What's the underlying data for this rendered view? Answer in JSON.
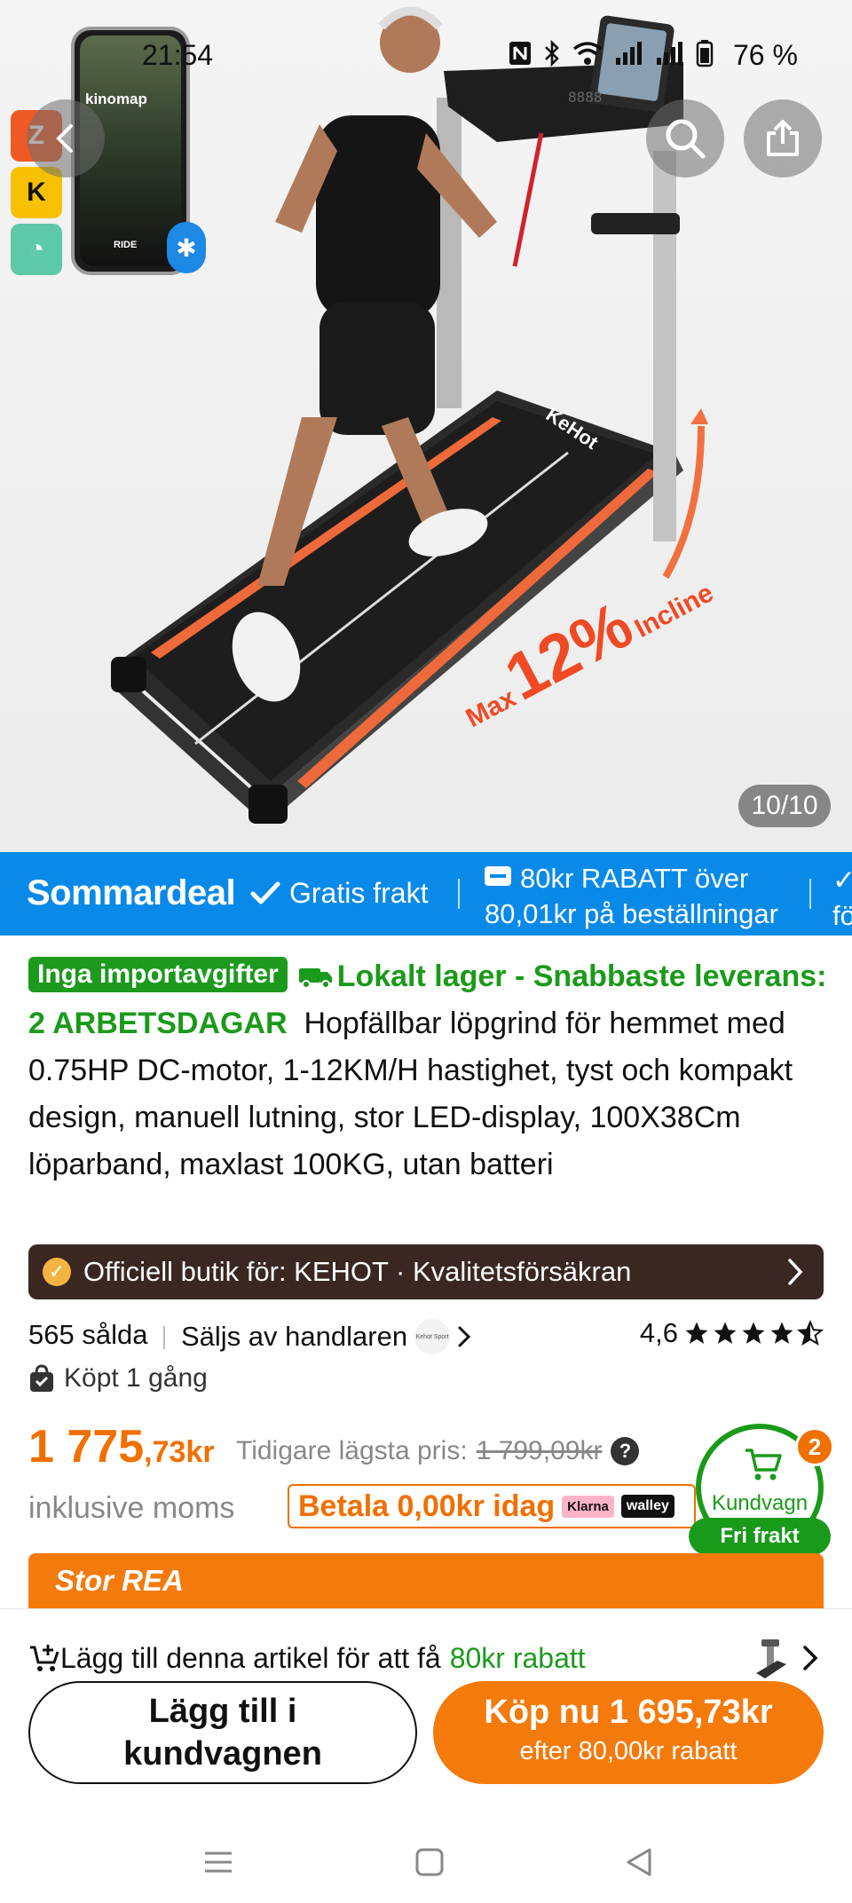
{
  "status_bar": {
    "time": "21:54",
    "battery": "76 %",
    "icons": [
      "nfc-icon",
      "bluetooth-icon",
      "wifi-icon",
      "signal-icon",
      "signal-icon",
      "battery-icon"
    ]
  },
  "hero": {
    "image_counter": "10/10",
    "phone_brand": "kinomap",
    "phone_label": "RIDE",
    "treadmill_brand": "KeHot",
    "incline_text_max": "Max",
    "incline_text_pct": "12%",
    "incline_text_label": "Incline",
    "console_digits": "8888"
  },
  "promo": {
    "title": "Sommardeal",
    "free_shipping": "Gratis frakt",
    "discount_line1": "80kr RABATT över",
    "discount_line2": "80,01kr på beställningar",
    "trailing_line1": "",
    "trailing_line2": "fö"
  },
  "description": {
    "tag": "Inga importavgifter",
    "local_stock": "Lokalt lager - Snabbaste leverans: 2 ARBETSDAGAR",
    "text": "Hopfällbar löpgrind för hemmet med 0.75HP DC-motor, 1-12KM/H hastighet, tyst och kompakt design, manuell lutning, stor LED-display, 100X38Cm löparband, maxlast 100KG, utan batteri"
  },
  "store": {
    "label": "Officiell butik för: KEHOT · Kvalitetsförsäkran"
  },
  "stats": {
    "sold": "565 sålda",
    "seller": "Säljs av handlaren",
    "seller_logo": "Kehot Sport",
    "rating_value": "4,6",
    "rating": 4.6,
    "bought": "Köpt 1 gång"
  },
  "price": {
    "main": "1 775",
    "cents": ",73kr",
    "previous_label": "Tidigare lägsta pris:",
    "previous_value": "1 799,09kr",
    "vat": "inklusive moms",
    "pay_today": "Betala 0,00kr idag",
    "klarna": "Klarna",
    "walley": "walley"
  },
  "cart": {
    "label": "Kundvagn",
    "count": "2",
    "free_shipping": "Fri frakt"
  },
  "sale_banner": "Stor REA",
  "addon": {
    "text": "Lägg till denna artikel för att få",
    "highlight": "80kr rabatt"
  },
  "buttons": {
    "add_to_cart": "Lägg till i kundvagnen",
    "buy_now": "Köp nu 1 695,73kr",
    "buy_now_sub": "efter 80,00kr rabatt"
  },
  "colors": {
    "accent_orange": "#f07000",
    "promo_blue": "#0a8ae8",
    "green": "#1a9a1a",
    "store_brown": "#3a2722"
  }
}
